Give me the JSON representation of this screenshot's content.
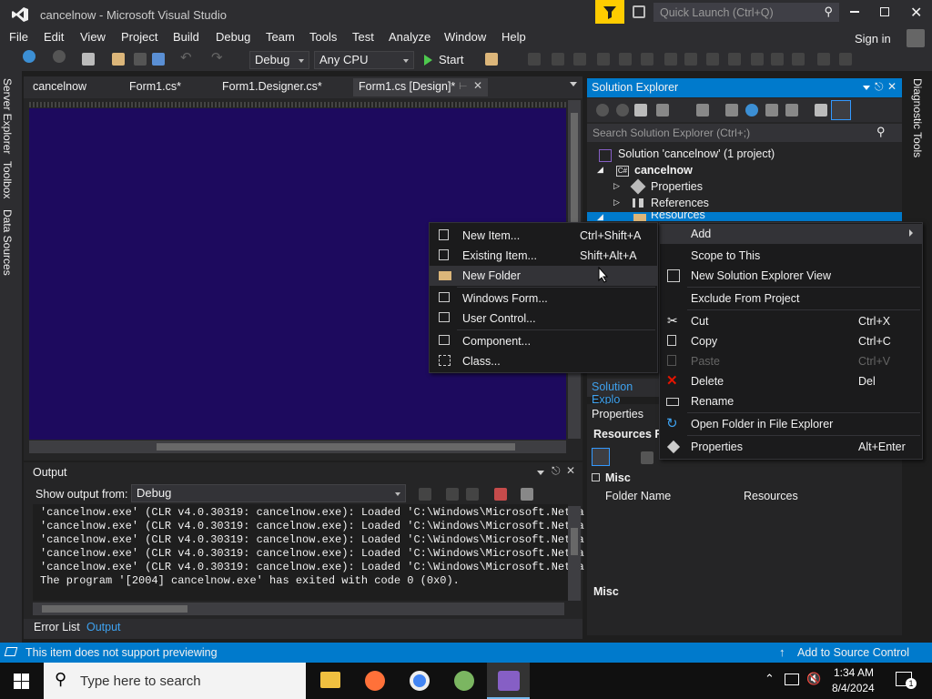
{
  "window": {
    "title": "cancelnow - Microsoft Visual Studio",
    "quick_launch": "Quick Launch (Ctrl+Q)",
    "sign_in": "Sign in"
  },
  "menu": [
    "File",
    "Edit",
    "View",
    "Project",
    "Build",
    "Debug",
    "Team",
    "Tools",
    "Test",
    "Analyze",
    "Window",
    "Help"
  ],
  "toolbar": {
    "config": "Debug",
    "platform": "Any CPU",
    "start": "Start"
  },
  "tabs": [
    "cancelnow",
    "Form1.cs*",
    "Form1.Designer.cs*",
    "Form1.cs [Design]*"
  ],
  "side_tabs": [
    "Server Explorer",
    "Toolbox",
    "Data Sources"
  ],
  "right_side_tab": "Diagnostic Tools",
  "solution_explorer": {
    "title": "Solution Explorer",
    "search_placeholder": "Search Solution Explorer (Ctrl+;)",
    "items": [
      "Solution 'cancelnow' (1 project)",
      "cancelnow",
      "Properties",
      "References",
      "Resources"
    ],
    "bottom_tab": "Solution Explo"
  },
  "properties": {
    "title": "Properties",
    "object": "Resources F",
    "category": "Misc",
    "rows": [
      {
        "name": "Folder Name",
        "value": "Resources"
      }
    ],
    "desc_title": "Misc"
  },
  "output": {
    "title": "Output",
    "show_from_label": "Show output from:",
    "show_from_value": "Debug",
    "lines": [
      "'cancelnow.exe' (CLR v4.0.30319: cancelnow.exe): Loaded 'C:\\Windows\\Microsoft.Net\\a",
      "'cancelnow.exe' (CLR v4.0.30319: cancelnow.exe): Loaded 'C:\\Windows\\Microsoft.Net\\a",
      "'cancelnow.exe' (CLR v4.0.30319: cancelnow.exe): Loaded 'C:\\Windows\\Microsoft.Net\\a",
      "'cancelnow.exe' (CLR v4.0.30319: cancelnow.exe): Loaded 'C:\\Windows\\Microsoft.Net\\a",
      "'cancelnow.exe' (CLR v4.0.30319: cancelnow.exe): Loaded 'C:\\Windows\\Microsoft.Net\\a",
      "The program '[2004] cancelnow.exe' has exited with code 0 (0x0)."
    ],
    "bottom_tabs": [
      "Error List",
      "Output"
    ]
  },
  "context_menu": {
    "items": [
      {
        "label": "Add",
        "shortcut": "",
        "icon": "",
        "disabled": false
      },
      {
        "label": "Scope to This",
        "shortcut": "",
        "icon": "",
        "disabled": false
      },
      {
        "label": "New Solution Explorer View",
        "shortcut": "",
        "icon": "new-view-icon",
        "disabled": false
      },
      {
        "label": "Exclude From Project",
        "shortcut": "",
        "icon": "",
        "disabled": false
      },
      {
        "label": "Cut",
        "shortcut": "Ctrl+X",
        "icon": "cut-icon",
        "disabled": false
      },
      {
        "label": "Copy",
        "shortcut": "Ctrl+C",
        "icon": "copy-icon",
        "disabled": false
      },
      {
        "label": "Paste",
        "shortcut": "Ctrl+V",
        "icon": "paste-icon",
        "disabled": true
      },
      {
        "label": "Delete",
        "shortcut": "Del",
        "icon": "delete-icon",
        "disabled": false
      },
      {
        "label": "Rename",
        "shortcut": "",
        "icon": "rename-icon",
        "disabled": false
      },
      {
        "label": "Open Folder in File Explorer",
        "shortcut": "",
        "icon": "refresh-icon",
        "disabled": false
      },
      {
        "label": "Properties",
        "shortcut": "Alt+Enter",
        "icon": "wrench-icon",
        "disabled": false
      }
    ]
  },
  "add_submenu": {
    "items": [
      {
        "label": "New Item...",
        "shortcut": "Ctrl+Shift+A"
      },
      {
        "label": "Existing Item...",
        "shortcut": "Shift+Alt+A"
      },
      {
        "label": "New Folder",
        "shortcut": ""
      },
      {
        "label": "Windows Form...",
        "shortcut": ""
      },
      {
        "label": "User Control...",
        "shortcut": ""
      },
      {
        "label": "Component...",
        "shortcut": ""
      },
      {
        "label": "Class...",
        "shortcut": ""
      }
    ]
  },
  "status": {
    "left": "This item does not support previewing",
    "right": "Add to Source Control"
  },
  "taskbar": {
    "search": "Type here to search",
    "time": "1:34 AM",
    "date": "8/4/2024",
    "notifications": "1"
  },
  "colors": {
    "accent": "#007acc",
    "designer_bg": "#1d0a5e",
    "vs_purple": "#865fc5"
  }
}
